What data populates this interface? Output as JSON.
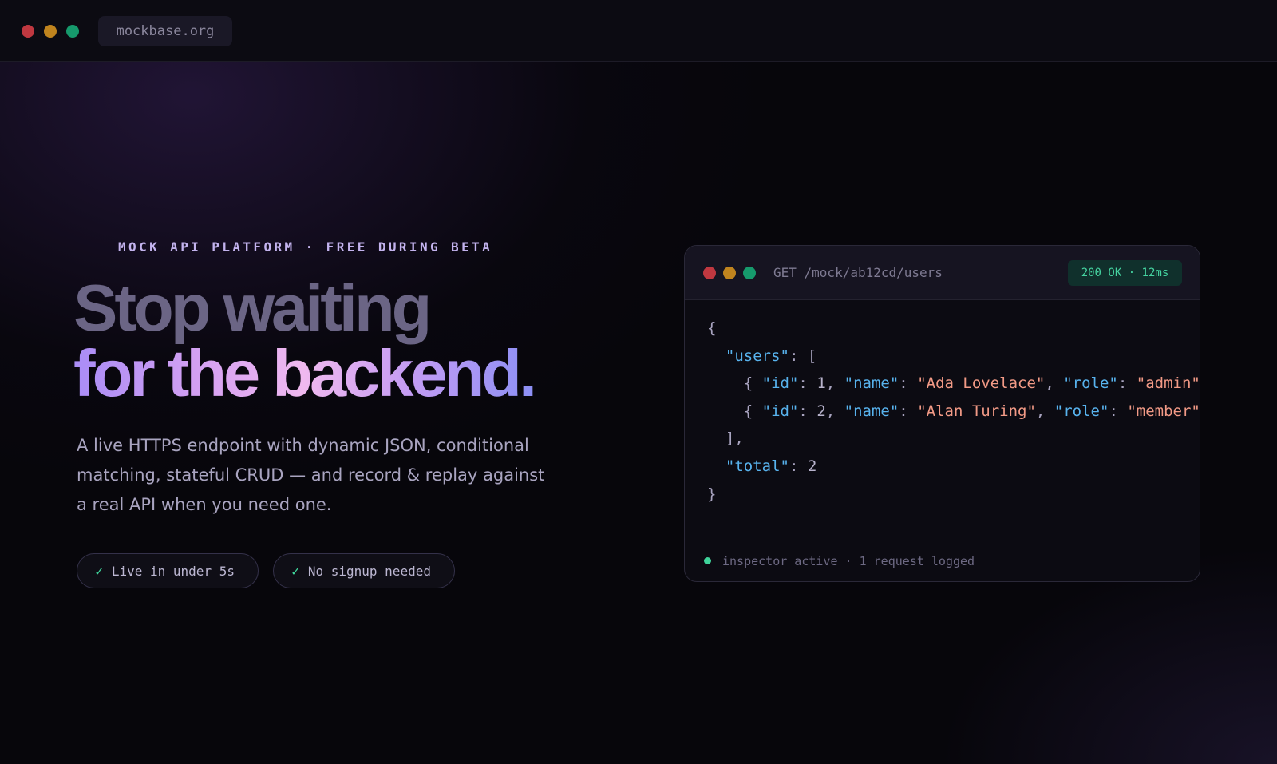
{
  "browser": {
    "url": "mockbase.org",
    "dots": [
      "#c03840",
      "#c0841e",
      "#169a6c"
    ]
  },
  "hero": {
    "eyebrow": "MOCK API PLATFORM · FREE DURING BETA",
    "title_line1": "Stop waiting",
    "title_line2": "for the backend.",
    "description": "A live HTTPS endpoint with dynamic JSON, conditional matching, stateful CRUD — and record & replay against a real API when you need one.",
    "features": [
      {
        "label": "Live in under 5s",
        "icon": "check-icon"
      },
      {
        "label": "No signup needed",
        "icon": "check-icon"
      }
    ]
  },
  "panel": {
    "request": "GET /mock/ab12cd/users",
    "status": "200 OK · 12ms",
    "footer": "inspector active · 1 request logged",
    "response": {
      "open": "{",
      "users_key": "\"users\"",
      "array_open": "[",
      "users": [
        {
          "id": "1",
          "name": "\"Ada Lovelace\"",
          "role": "\"admin\""
        },
        {
          "id": "2",
          "name": "\"Alan Turing\"",
          "role": "\"member\""
        }
      ],
      "array_close": "],",
      "total_key": "\"total\"",
      "total": "2",
      "close": "}"
    },
    "keys": {
      "id": "\"id\"",
      "name": "\"name\"",
      "role": "\"role\""
    }
  },
  "colors": {
    "accent": "#a98cf6",
    "success": "#3fd39a",
    "json_key": "#58b3ee",
    "json_string": "#f29a86"
  }
}
